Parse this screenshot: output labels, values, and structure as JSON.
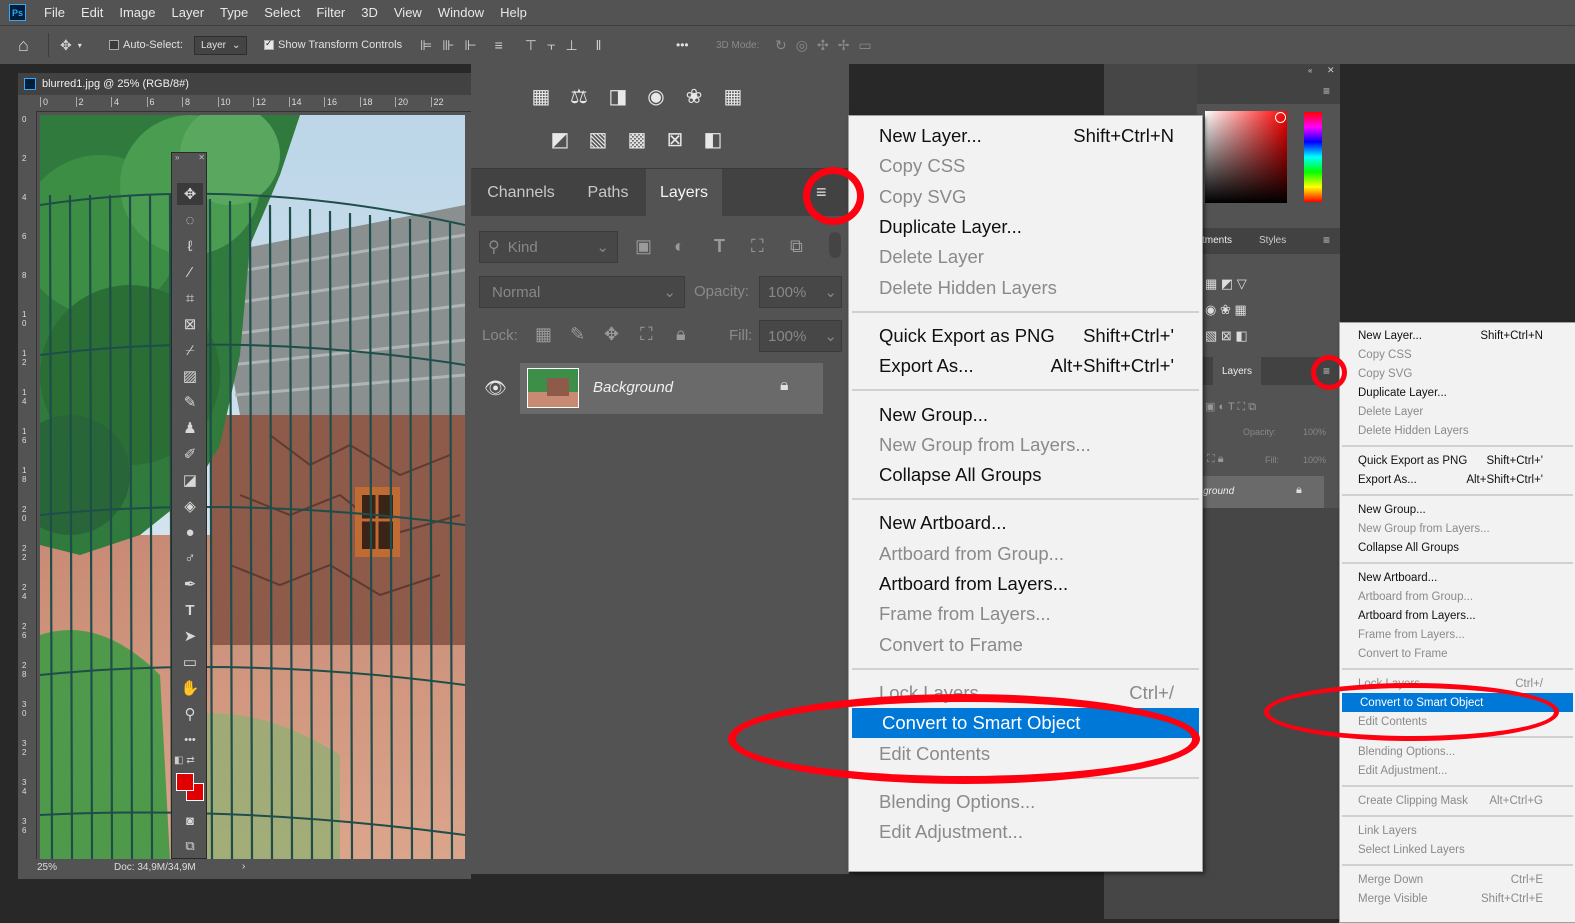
{
  "menubar": {
    "logo": "Ps",
    "items": [
      "File",
      "Edit",
      "Image",
      "Layer",
      "Type",
      "Select",
      "Filter",
      "3D",
      "View",
      "Window",
      "Help"
    ]
  },
  "options": {
    "auto_select_label": "Auto-Select:",
    "layer_dropdown": "Layer",
    "show_transform_label": "Show Transform Controls",
    "mode_label": "3D Mode:",
    "more": "•••"
  },
  "document": {
    "title": "blurred1.jpg @ 25% (RGB/8#)",
    "ruler_h": [
      "0",
      "2",
      "4",
      "6",
      "8",
      "10",
      "12",
      "14",
      "16",
      "18",
      "20",
      "22"
    ],
    "ruler_v": [
      "0",
      "2",
      "4",
      "6",
      "8",
      "1 0",
      "1 2",
      "1 4",
      "1 6",
      "1 8",
      "2 0",
      "2 2",
      "2 4",
      "2 6",
      "2 8",
      "3 0",
      "3 2",
      "3 4",
      "3 6"
    ],
    "zoom": "25%",
    "doc_size": "Doc: 34,9M/34,9M"
  },
  "layers_panel": {
    "tabs": [
      "Channels",
      "Paths",
      "Layers"
    ],
    "active_tab": "Layers",
    "kind_placeholder": "Kind",
    "blend_mode": "Normal",
    "opacity_label": "Opacity:",
    "opacity_value": "100%",
    "lock_label": "Lock:",
    "fill_label": "Fill:",
    "fill_value": "100%",
    "layer_name": "Background"
  },
  "context_menu": {
    "items": [
      {
        "label": "New Layer...",
        "shortcut": "Shift+Ctrl+N",
        "disabled": false
      },
      {
        "label": "Copy CSS",
        "shortcut": "",
        "disabled": true
      },
      {
        "label": "Copy SVG",
        "shortcut": "",
        "disabled": true
      },
      {
        "label": "Duplicate Layer...",
        "shortcut": "",
        "disabled": false
      },
      {
        "label": "Delete Layer",
        "shortcut": "",
        "disabled": true
      },
      {
        "label": "Delete Hidden Layers",
        "shortcut": "",
        "disabled": true
      },
      {
        "label": "Quick Export as PNG",
        "shortcut": "Shift+Ctrl+'",
        "disabled": false
      },
      {
        "label": "Export As...",
        "shortcut": "Alt+Shift+Ctrl+'",
        "disabled": false
      },
      {
        "label": "New Group...",
        "shortcut": "",
        "disabled": false
      },
      {
        "label": "New Group from Layers...",
        "shortcut": "",
        "disabled": true
      },
      {
        "label": "Collapse All Groups",
        "shortcut": "",
        "disabled": false
      },
      {
        "label": "New Artboard...",
        "shortcut": "",
        "disabled": false
      },
      {
        "label": "Artboard from Group...",
        "shortcut": "",
        "disabled": true
      },
      {
        "label": "Artboard from Layers...",
        "shortcut": "",
        "disabled": false
      },
      {
        "label": "Frame from Layers...",
        "shortcut": "",
        "disabled": true
      },
      {
        "label": "Convert to Frame",
        "shortcut": "",
        "disabled": true
      },
      {
        "label": "Lock Layers...",
        "shortcut": "Ctrl+/",
        "disabled": true
      },
      {
        "label": "Convert to Smart Object",
        "shortcut": "",
        "disabled": false,
        "selected": true
      },
      {
        "label": "Edit Contents",
        "shortcut": "",
        "disabled": true
      },
      {
        "label": "Blending Options...",
        "shortcut": "",
        "disabled": true
      },
      {
        "label": "Edit Adjustment...",
        "shortcut": "",
        "disabled": true
      },
      {
        "label": "Create Clipping Mask",
        "shortcut": "Alt+Ctrl+G",
        "disabled": true
      },
      {
        "label": "Link Layers",
        "shortcut": "",
        "disabled": true
      },
      {
        "label": "Select Linked Layers",
        "shortcut": "",
        "disabled": true
      },
      {
        "label": "Merge Down",
        "shortcut": "Ctrl+E",
        "disabled": true
      },
      {
        "label": "Merge Visible",
        "shortcut": "Shift+Ctrl+E",
        "disabled": true
      }
    ]
  },
  "right_panel": {
    "tab_adjustments_partial": "stments",
    "tab_styles": "Styles",
    "layers_tab": "Layers",
    "opacity_label": "Opacity:",
    "opacity_value": "100%",
    "fill_label": "Fill:",
    "fill_value": "100%",
    "layer_name_partial": "ground"
  },
  "colors": {
    "accent_red": "#ff0010",
    "selection_blue": "#0078d7",
    "ui_gray": "#535353"
  }
}
